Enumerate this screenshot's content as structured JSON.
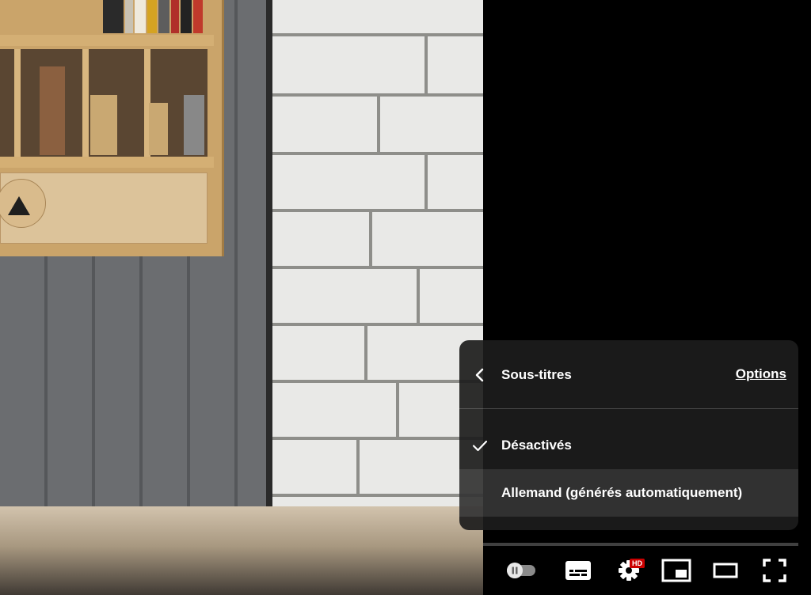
{
  "captions_menu": {
    "title": "Sous-titres",
    "options_label": "Options",
    "items": [
      {
        "label": "Désactivés",
        "selected": true
      },
      {
        "label": "Allemand (générés automatiquement)",
        "selected": false
      }
    ]
  },
  "controls": {
    "autoplay_enabled": false,
    "hd_badge": "HD",
    "icons": [
      "autoplay-toggle-icon",
      "subtitles-icon",
      "settings-gear-icon",
      "miniplayer-icon",
      "theater-mode-icon",
      "fullscreen-icon"
    ]
  },
  "colors": {
    "menu_background": "#1c1c1c",
    "text": "#ffffff",
    "hd_badge": "#cc0000",
    "player_background": "#000000"
  }
}
